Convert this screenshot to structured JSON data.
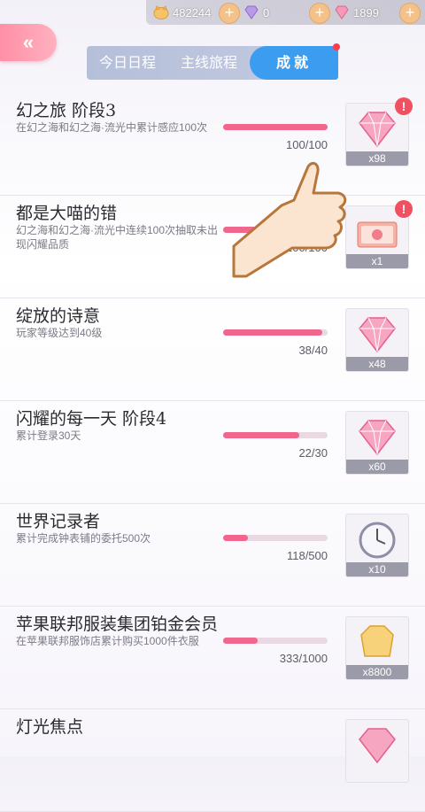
{
  "currency": [
    {
      "icon": "cat-coin-icon",
      "value": "482244"
    },
    {
      "icon": "purple-diamond-icon",
      "value": "0"
    },
    {
      "icon": "pink-diamond-icon",
      "value": "1899"
    }
  ],
  "back_label": "«",
  "tabs": [
    {
      "label": "今日日程"
    },
    {
      "label": "主线旅程"
    },
    {
      "label": "成就",
      "active": true
    }
  ],
  "achievements": [
    {
      "title": "幻之旅 阶段3",
      "desc": "在幻之海和幻之海·流光中累计感应100次",
      "progress": "100/100",
      "ratio": 1.0,
      "reward_icon": "pink-diamond-icon",
      "reward_qty": "x98",
      "alert": true
    },
    {
      "title": "都是大喵的错",
      "desc": "幻之海和幻之海·流光中连续100次抽取未出现闪耀品质",
      "progress": "100/100",
      "ratio": 1.0,
      "reward_icon": "gift-ticket-icon",
      "reward_qty": "x1",
      "alert": true
    },
    {
      "title": "绽放的诗意",
      "desc": "玩家等级达到40级",
      "progress": "38/40",
      "ratio": 0.95,
      "reward_icon": "pink-diamond-icon",
      "reward_qty": "x48",
      "alert": false
    },
    {
      "title": "闪耀的每一天 阶段4",
      "desc": "累计登录30天",
      "progress": "22/30",
      "ratio": 0.73,
      "reward_icon": "pink-diamond-icon",
      "reward_qty": "x60",
      "alert": false
    },
    {
      "title": "世界记录者",
      "desc": "累计完成钟表铺的委托500次",
      "progress": "118/500",
      "ratio": 0.24,
      "reward_icon": "clock-icon",
      "reward_qty": "x10",
      "alert": false
    },
    {
      "title": "苹果联邦服装集团铂金会员",
      "desc": "在苹果联邦服饰店累计购买1000件衣服",
      "progress": "333/1000",
      "ratio": 0.33,
      "reward_icon": "gold-coin-icon",
      "reward_qty": "x8800",
      "alert": false
    },
    {
      "title": "灯光焦点",
      "desc": "",
      "progress": "",
      "ratio": null,
      "reward_icon": "pink-diamond-icon",
      "reward_qty": "",
      "alert": false
    }
  ],
  "colors": {
    "accent_pink": "#f0668c",
    "active_tab": "#3c9df0",
    "alert_red": "#f0505f"
  }
}
